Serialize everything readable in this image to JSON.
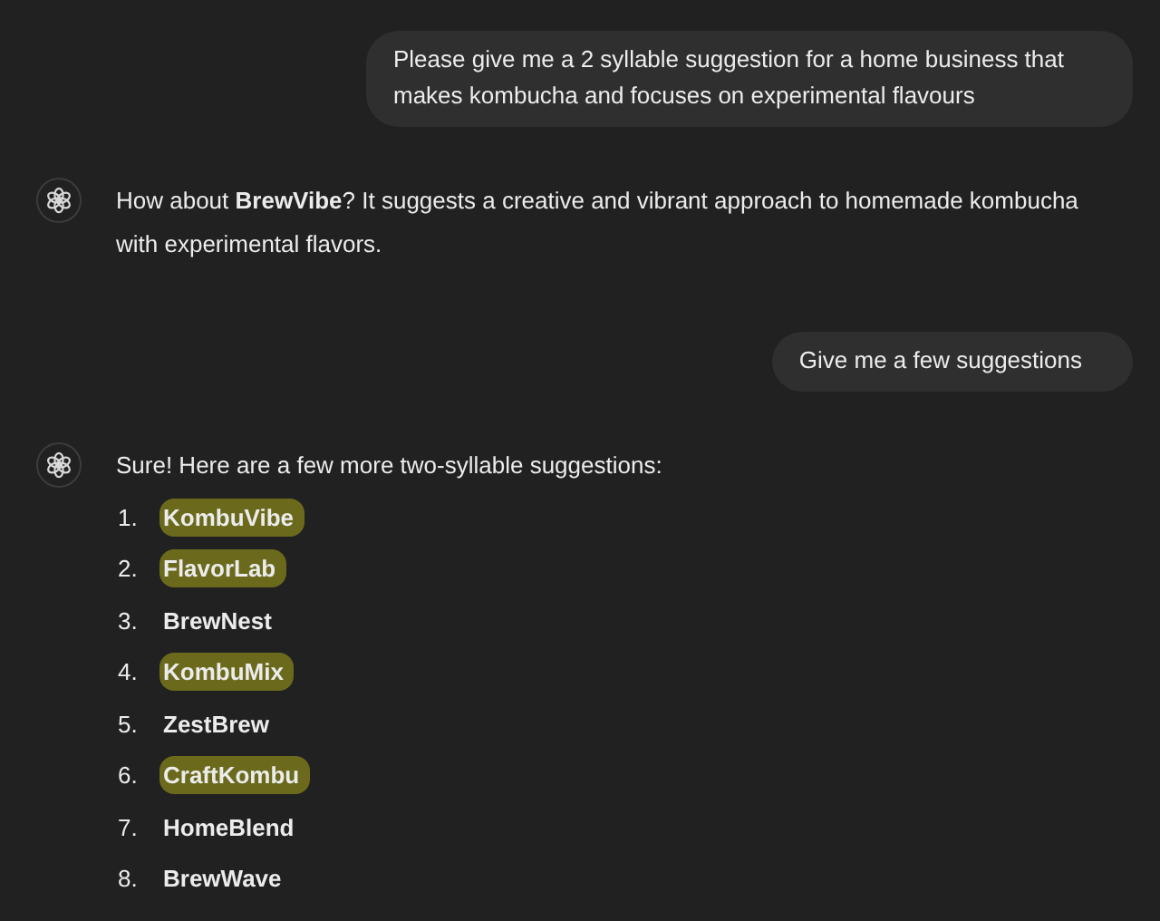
{
  "messages": [
    {
      "kind": "user",
      "text": "Please give me a 2 syllable suggestion for a home business that makes kombucha and focuses on experimental flavours"
    },
    {
      "kind": "assistant",
      "text": "How about **BrewVibe**? It suggests a creative and vibrant approach to homemade kombucha with experimental flavors."
    },
    {
      "kind": "user",
      "text": "Give me a few suggestions"
    },
    {
      "kind": "assistant",
      "text": "Sure! Here are a few more two-syllable suggestions:",
      "items": [
        {
          "number": "1.",
          "name": "KombuVibe",
          "highlighted": true
        },
        {
          "number": "2.",
          "name": "FlavorLab",
          "highlighted": true
        },
        {
          "number": "3.",
          "name": "BrewNest",
          "highlighted": false
        },
        {
          "number": "4.",
          "name": "KombuMix",
          "highlighted": true
        },
        {
          "number": "5.",
          "name": "ZestBrew",
          "highlighted": false
        },
        {
          "number": "6.",
          "name": "CraftKombu",
          "highlighted": true
        },
        {
          "number": "7.",
          "name": "HomeBlend",
          "highlighted": false
        },
        {
          "number": "8.",
          "name": "BrewWave",
          "highlighted": false
        }
      ]
    }
  ]
}
